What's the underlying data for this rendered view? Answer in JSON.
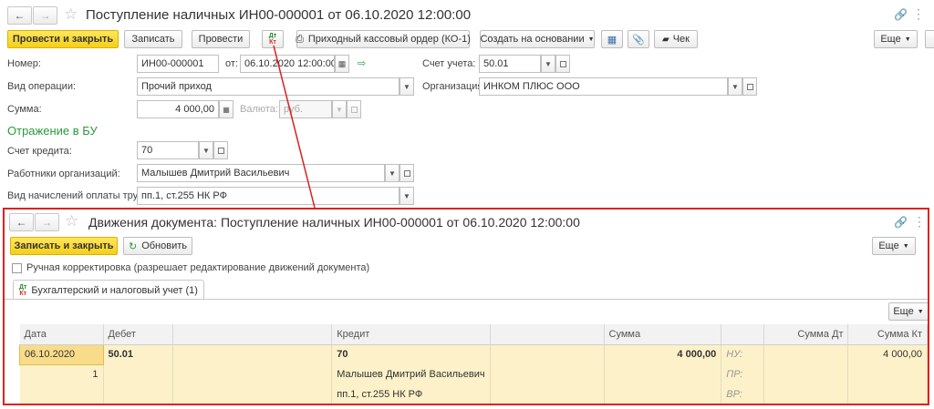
{
  "doc": {
    "title": "Поступление наличных ИН00-000001 от 06.10.2020 12:00:00",
    "toolbar": {
      "post_close": "Провести и закрыть",
      "save": "Записать",
      "post": "Провести",
      "pko": "Приходный кассовый ордер (КО-1)",
      "create_based": "Создать на основании",
      "check": "Чек",
      "more": "Еще"
    },
    "form": {
      "number_label": "Номер:",
      "number_value": "ИН00-000001",
      "date_label": "от:",
      "date_value": "06.10.2020 12:00:00",
      "account_label": "Счет учета:",
      "account_value": "50.01",
      "operation_label": "Вид операции:",
      "operation_value": "Прочий приход",
      "org_label": "Организация:",
      "org_value": "ИНКОМ ПЛЮС ООО",
      "sum_label": "Сумма:",
      "sum_value": "4 000,00",
      "currency_label": "Валюта:",
      "currency_value": "руб.",
      "section_title": "Отражение в БУ",
      "credit_label": "Счет кредита:",
      "credit_value": "70",
      "workers_label": "Работники организаций:",
      "workers_value": "Малышев Дмитрий Васильевич",
      "payment_label": "Вид начислений оплаты труда:",
      "payment_value": "пп.1, ст.255 НК РФ"
    }
  },
  "movements": {
    "title": "Движения документа: Поступление наличных ИН00-000001 от 06.10.2020 12:00:00",
    "save_close": "Записать и закрыть",
    "refresh": "Обновить",
    "more": "Еще",
    "manual_label": "Ручная корректировка (разрешает редактирование движений документа)",
    "tab_label": "Бухгалтерский и налоговый учет (1)",
    "table_more": "Еще",
    "columns": [
      "Дата",
      "Дебет",
      "",
      "Кредит",
      "",
      "Сумма",
      "",
      "Сумма Дт",
      "Сумма Кт"
    ],
    "rows": [
      [
        "06.10.2020",
        "50.01",
        "",
        "70",
        "",
        "4 000,00",
        "НУ:",
        "",
        "4 000,00"
      ],
      [
        "1",
        "",
        "",
        "Малышев Дмитрий Васильевич",
        "",
        "",
        "ПР:",
        "",
        ""
      ],
      [
        "",
        "",
        "",
        "пп.1, ст.255 НК РФ",
        "",
        "",
        "ВР:",
        "",
        ""
      ]
    ]
  },
  "icons": {
    "dtkt_top": "Дт",
    "dtkt_bottom": "Кт"
  }
}
